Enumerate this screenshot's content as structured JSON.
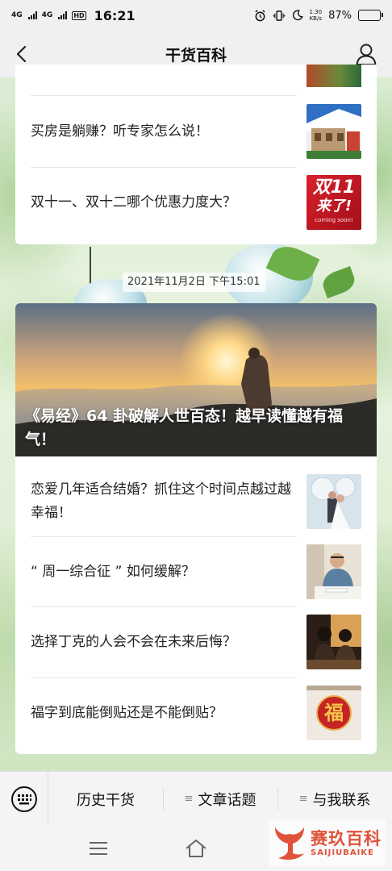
{
  "status_bar": {
    "sim1": "4G",
    "sim2": "4G",
    "hd": "HD",
    "time": "16:21",
    "speed_value": "1.30",
    "speed_unit": "KB/s",
    "battery": "87%",
    "battery_level": 0.87
  },
  "header": {
    "title": "干货百科",
    "back_icon": "chevron-left-icon",
    "profile_icon": "person-icon"
  },
  "feed": {
    "top_articles": [
      {
        "title": "买房是躺赚？听专家怎么说！",
        "thumb": "house-thumbnail"
      },
      {
        "title": "双十一、双十二哪个优惠力度大？",
        "thumb": "double-11-thumbnail",
        "thumb_text_main": "双11",
        "thumb_text_sub": "来了!",
        "thumb_text_small": "coming soon!"
      }
    ],
    "date": "2021年11月2日 下午15:01",
    "hero": {
      "title": "《易经》64 卦破解人世百态！越早读懂越有福气！"
    },
    "articles": [
      {
        "title": "恋爱几年适合结婚？抓住这个时间点越过越幸福！",
        "thumb": "wedding-thumbnail"
      },
      {
        "title": "“ 周一综合征 ” 如何缓解？",
        "thumb": "office-man-thumbnail"
      },
      {
        "title": "选择丁克的人会不会在未来后悔？",
        "thumb": "couple-thumbnail"
      },
      {
        "title": "福字到底能倒贴还是不能倒贴？",
        "thumb": "fu-character-thumbnail",
        "thumb_text": "福"
      }
    ]
  },
  "menu": {
    "keyboard_icon": "keyboard-icon",
    "items": [
      {
        "label": "历史干货"
      },
      {
        "label": "文章话题"
      },
      {
        "label": "与我联系"
      }
    ]
  },
  "watermark": {
    "cn": "赛玖百科",
    "en": "SAIJIUBAIKE"
  },
  "colors": {
    "accent_battery": "#f2b21c",
    "watermark": "#e0533a"
  }
}
